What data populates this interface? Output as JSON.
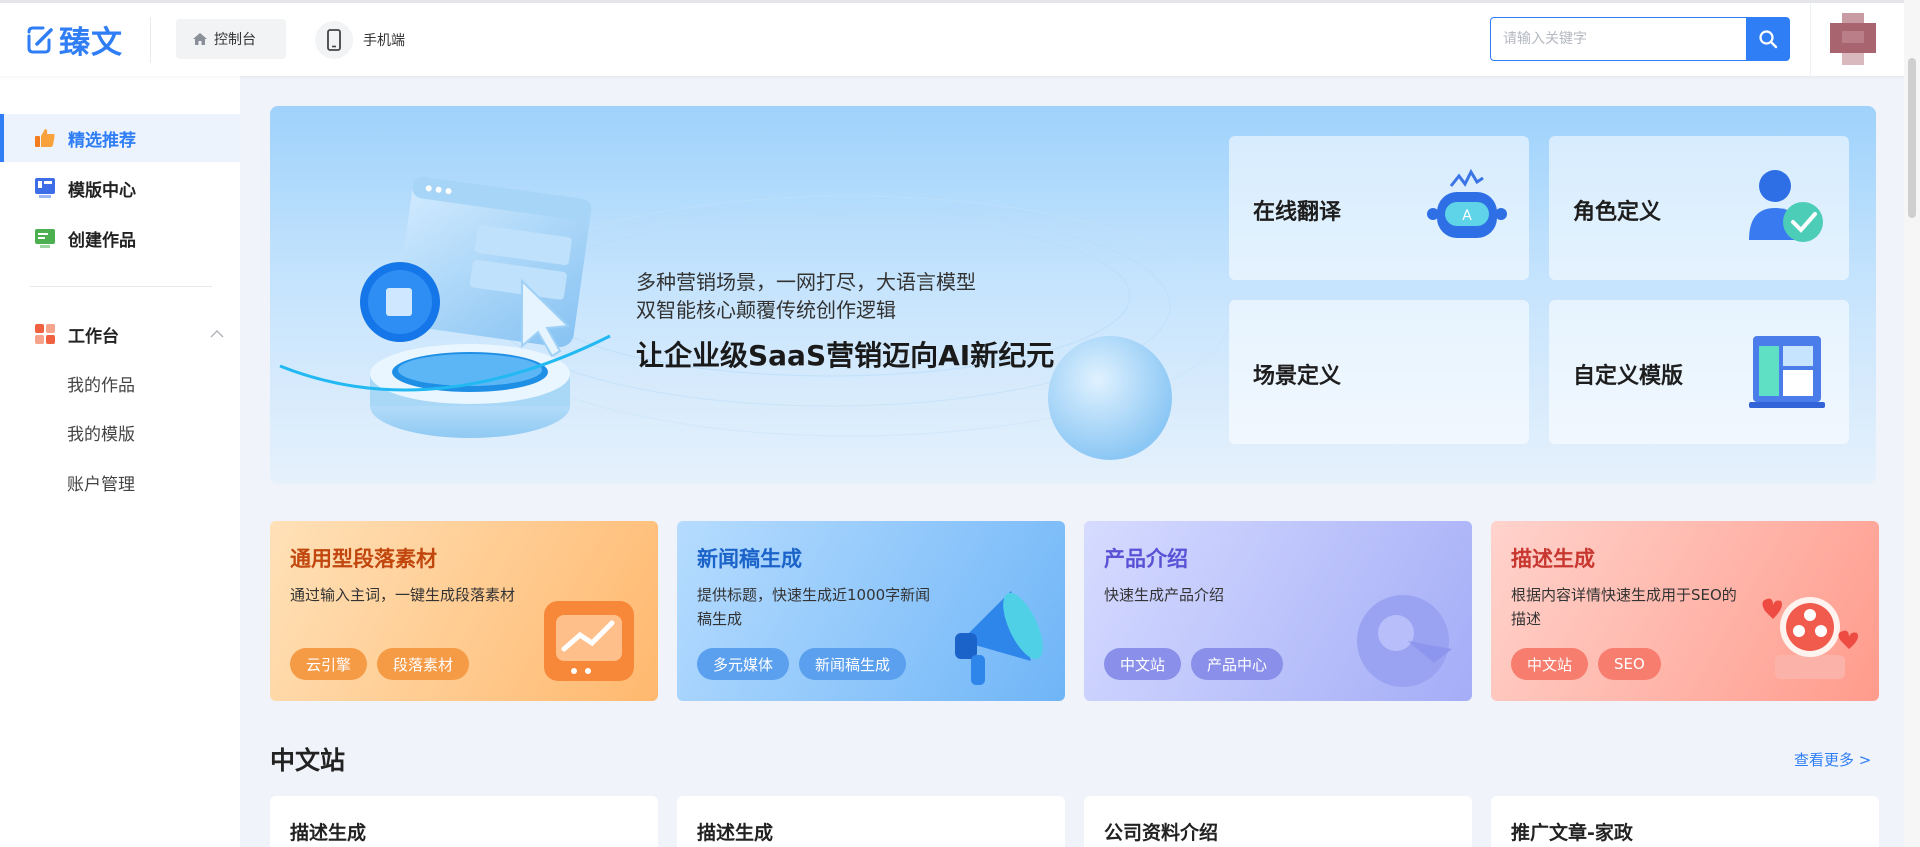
{
  "brand": {
    "name": "臻文",
    "accent": "#2f7ef5"
  },
  "header": {
    "console_label": "控制台",
    "mobile_label": "手机端",
    "search": {
      "placeholder": "请输入关键字"
    }
  },
  "sidebar": {
    "main_items": [
      {
        "label": "精选推荐",
        "icon": "thumbs-up-icon",
        "active": true
      },
      {
        "label": "模版中心",
        "icon": "template-icon"
      },
      {
        "label": "创建作品",
        "icon": "create-icon"
      }
    ],
    "workspace": {
      "label": "工作台",
      "icon": "workspace-icon",
      "sub_items": [
        "我的作品",
        "我的模版",
        "账户管理"
      ]
    }
  },
  "banner": {
    "line1": "多种营销场景，一网打尽，大语言模型",
    "line2": "双智能核心颠覆传统创作逻辑",
    "headline": "让企业级SaaS营销迈向AI新纪元",
    "tiles": [
      {
        "label": "在线翻译",
        "icon": "robot-icon"
      },
      {
        "label": "角色定义",
        "icon": "user-check-icon"
      },
      {
        "label": "场景定义",
        "icon": "scene-icon"
      },
      {
        "label": "自定义模版",
        "icon": "layout-icon"
      }
    ]
  },
  "feature_cards": [
    {
      "title": "通用型段落素材",
      "desc": "通过输入主词，一键生成段落素材",
      "tags": [
        "云引擎",
        "段落素材"
      ],
      "title_color": "#c1470f"
    },
    {
      "title": "新闻稿生成",
      "desc": "提供标题，快速生成近1000字新闻稿生成",
      "tags": [
        "多元媒体",
        "新闻稿生成"
      ],
      "title_color": "#1b63c9"
    },
    {
      "title": "产品介绍",
      "desc": "快速生成产品介绍",
      "tags": [
        "中文站",
        "产品中心"
      ],
      "title_color": "#5a52d6"
    },
    {
      "title": "描述生成",
      "desc": "根据内容详情快速生成用于SEO的描述",
      "tags": [
        "中文站",
        "SEO"
      ],
      "title_color": "#c8372f"
    }
  ],
  "section": {
    "title": "中文站",
    "more_label": "查看更多 >",
    "cards": [
      "描述生成",
      "描述生成",
      "公司资料介绍",
      "推广文章-家政"
    ]
  }
}
